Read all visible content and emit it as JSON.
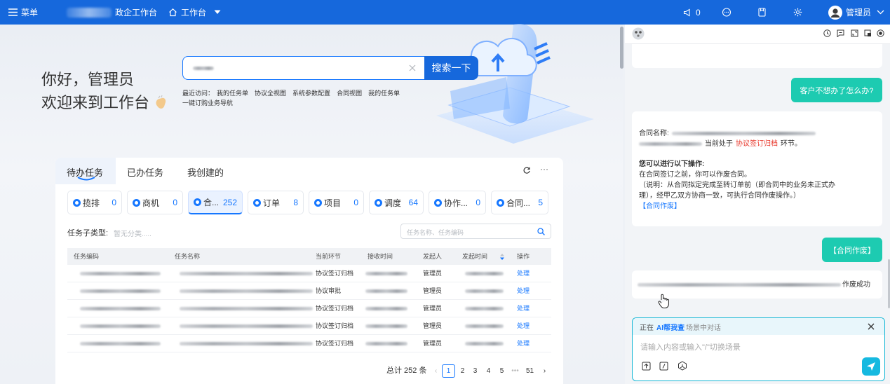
{
  "topbar": {
    "menu_label": "菜单",
    "brand_suffix": "政企工作台",
    "workspace_label": "工作台",
    "notifications_count": "0",
    "user_name": "管理员"
  },
  "hero": {
    "greeting_line1": "你好，管理员",
    "greeting_line2": "欢迎来到工作台",
    "search_button": "搜索一下",
    "recent_label": "最近访问：",
    "recent_links": [
      "我的任务单",
      "协议全视图",
      "系统参数配置",
      "合同视图",
      "我的任务单"
    ],
    "recent_link_2": "一键订购业务导航"
  },
  "tasks": {
    "tabs": [
      "待办任务",
      "已办任务",
      "我创建的"
    ],
    "chips": [
      {
        "label": "揽排",
        "count": "0"
      },
      {
        "label": "商机",
        "count": "0"
      },
      {
        "label": "合...",
        "count": "252"
      },
      {
        "label": "订单",
        "count": "8"
      },
      {
        "label": "项目",
        "count": "0"
      },
      {
        "label": "调度",
        "count": "64"
      },
      {
        "label": "协作...",
        "count": "0"
      },
      {
        "label": "合同...",
        "count": "5"
      }
    ],
    "subtype_label": "任务子类型:",
    "subtype_placeholder": "暂无分类.....",
    "search_placeholder": "任务名称、任务编码",
    "columns": [
      "任务编码",
      "任务名称",
      "当前环节",
      "接收时间",
      "发起人",
      "发起时间",
      "操作"
    ],
    "rows": [
      {
        "stage": "协议签订归档",
        "initiator": "管理员",
        "action": "处理"
      },
      {
        "stage": "协议审批",
        "initiator": "管理员",
        "action": "处理"
      },
      {
        "stage": "协议签订归档",
        "initiator": "管理员",
        "action": "处理"
      },
      {
        "stage": "协议签订归档",
        "initiator": "管理员",
        "action": "处理"
      },
      {
        "stage": "协议签订归档",
        "initiator": "管理员",
        "action": "处理"
      }
    ],
    "total_text": "总计 252 条",
    "pages": [
      "1",
      "2",
      "3",
      "4",
      "5",
      "•••",
      "51"
    ]
  },
  "chat": {
    "user_msg_1": "客户不想办了怎么办?",
    "contract_label": "合同名称:",
    "stage_prefix": "当前处于",
    "stage_name": "协议签订归档",
    "stage_suffix": "环节。",
    "ops_title": "您可以进行以下操作:",
    "ops_line1": "在合同签订之前，你可以作废合同。",
    "ops_line2": "（说明：从合同拟定完成至转订单前（即合同中的业务未正式办",
    "ops_line3": "理），经甲乙双方协商一致，可执行合同作废操作。）",
    "ops_link": "【合同作废】",
    "user_msg_2": "【合同作废】",
    "result_suffix": "作废成功",
    "input_status_prefix": "正在",
    "input_status_name": "AI帮我查",
    "input_status_suffix": "场景中对话",
    "input_placeholder": "请输入内容或输入\"/\"切换场景"
  },
  "colors": {
    "brand": "#1668dc",
    "chat_user": "#1dcbb1",
    "accent": "#1677ff",
    "stage_red": "#e8392d"
  }
}
